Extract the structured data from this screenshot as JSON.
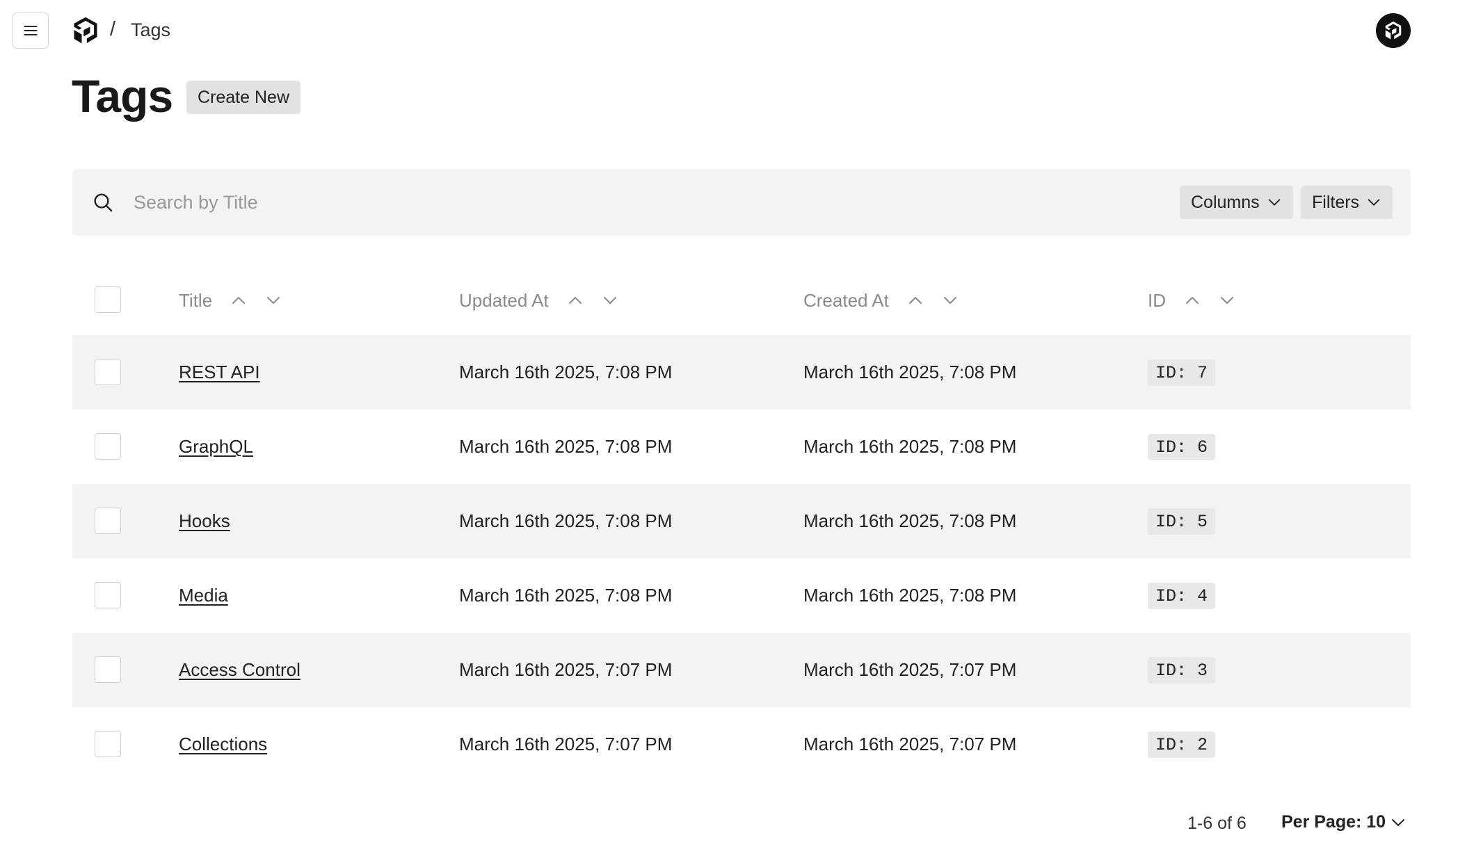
{
  "header": {
    "breadcrumb_separator": "/",
    "breadcrumb_current": "Tags"
  },
  "page": {
    "title": "Tags",
    "create_label": "Create New"
  },
  "search": {
    "placeholder": "Search by Title",
    "value": ""
  },
  "toolbar": {
    "columns_label": "Columns",
    "filters_label": "Filters"
  },
  "table": {
    "columns": [
      "Title",
      "Updated At",
      "Created At",
      "ID"
    ],
    "rows": [
      {
        "title": "REST API",
        "updated_at": "March 16th 2025, 7:08 PM",
        "created_at": "March 16th 2025, 7:08 PM",
        "id": "ID: 7"
      },
      {
        "title": "GraphQL",
        "updated_at": "March 16th 2025, 7:08 PM",
        "created_at": "March 16th 2025, 7:08 PM",
        "id": "ID: 6"
      },
      {
        "title": "Hooks",
        "updated_at": "March 16th 2025, 7:08 PM",
        "created_at": "March 16th 2025, 7:08 PM",
        "id": "ID: 5"
      },
      {
        "title": "Media",
        "updated_at": "March 16th 2025, 7:08 PM",
        "created_at": "March 16th 2025, 7:08 PM",
        "id": "ID: 4"
      },
      {
        "title": "Access Control",
        "updated_at": "March 16th 2025, 7:07 PM",
        "created_at": "March 16th 2025, 7:07 PM",
        "id": "ID: 3"
      },
      {
        "title": "Collections",
        "updated_at": "March 16th 2025, 7:07 PM",
        "created_at": "March 16th 2025, 7:07 PM",
        "id": "ID: 2"
      }
    ]
  },
  "pagination": {
    "range": "1-6 of 6",
    "per_page": "Per Page: 10"
  },
  "icons": {
    "menu": "hamburger-menu-icon",
    "logo": "payload-logo-icon",
    "search": "search-icon",
    "chevron": "chevron-down-icon",
    "sort_asc": "chevron-up-icon",
    "sort_desc": "chevron-down-icon",
    "avatar": "payload-logo-icon"
  },
  "colors": {
    "row_alt_bg": "#f3f3f3",
    "button_bg": "#e2e2e2",
    "header_text": "#8a8a8a",
    "avatar_bg": "#111111"
  }
}
